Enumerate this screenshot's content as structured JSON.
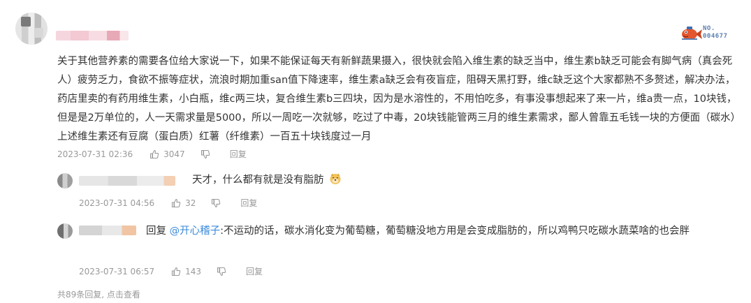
{
  "main_comment": {
    "text": "关于其他营养素的需要各位给大家说一下，如果不能保证每天有新鲜蔬果摄入，很快就会陷入维生素的缺乏当中，维生素b缺乏可能会有脚气病（真会死人）疲劳乏力，食欲不振等症状，流浪时期加重san值下降速率，维生素a缺乏会有夜盲症，阻碍天黑打野，维c缺乏这个大家都熟不多赘述，解决办法，药店里卖的有药用维生素，小白瓶，维c两三块，复合维生素b三四块，因为是水溶性的，不用怕吃多，有事没事想起来了来一片，维a贵一点，10块钱，但是是2万单位的，人一天需求量是5000，所以一周吃一次就够，吃过了中毒，20块钱能管两三月的维生素需求，鄙人曾靠五毛钱一块的方便面（碳水）上述维生素还有豆腐（蛋白质）红薯（纤维素）一百五十块钱度过一月",
    "timestamp": "2023-07-31 02:36",
    "views": "3047",
    "reply_label": "回复",
    "badge_no": "NO.",
    "badge_num": "004677"
  },
  "replies": [
    {
      "text": "天才，什么都有就是没有脂肪",
      "timestamp": "2023-07-31 04:56",
      "likes": "32",
      "reply_label": "回复",
      "emoji": "doge-icon"
    },
    {
      "reply_prefix": "回复",
      "mention": "@开心稽子",
      "text": ":不运动的话，碳水消化变为葡萄糖，葡萄糖没地方用是会变成脂肪的，所以鸡鸭只吃碳水蔬菜啥的也会胖",
      "timestamp": "2023-07-31 06:57",
      "likes": "143",
      "reply_label": "回复"
    }
  ],
  "footer": {
    "more_replies": "共89条回复, 点击查看"
  },
  "colors": {
    "text": "#333333",
    "meta": "#999999",
    "mention": "#3a8ad9",
    "sub_bg": "#f7f7f7"
  }
}
